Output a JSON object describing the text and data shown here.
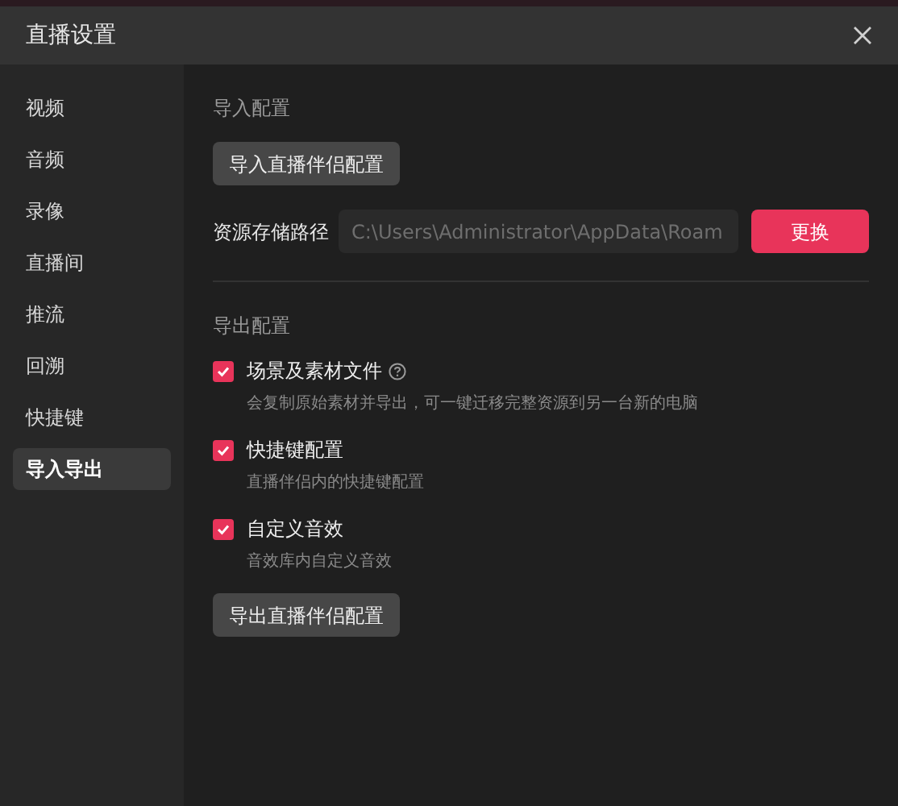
{
  "window": {
    "title": "直播设置"
  },
  "sidebar": {
    "items": [
      {
        "label": "视频",
        "selected": false
      },
      {
        "label": "音频",
        "selected": false
      },
      {
        "label": "录像",
        "selected": false
      },
      {
        "label": "直播间",
        "selected": false
      },
      {
        "label": "推流",
        "selected": false
      },
      {
        "label": "回溯",
        "selected": false
      },
      {
        "label": "快捷键",
        "selected": false
      },
      {
        "label": "导入导出",
        "selected": true
      }
    ]
  },
  "import_section": {
    "heading": "导入配置",
    "button": "导入直播伴侣配置",
    "path_label": "资源存储路径",
    "path_value": "C:\\Users\\Administrator\\AppData\\Roam",
    "change_button": "更换"
  },
  "export_section": {
    "heading": "导出配置",
    "options": [
      {
        "label": "场景及素材文件",
        "checked": true,
        "help": true,
        "description": "会复制原始素材并导出，可一键迁移完整资源到另一台新的电脑"
      },
      {
        "label": "快捷键配置",
        "checked": true,
        "help": false,
        "description": "直播伴侣内的快捷键配置"
      },
      {
        "label": "自定义音效",
        "checked": true,
        "help": false,
        "description": "音效库内自定义音效"
      }
    ],
    "button": "导出直播伴侣配置"
  }
}
